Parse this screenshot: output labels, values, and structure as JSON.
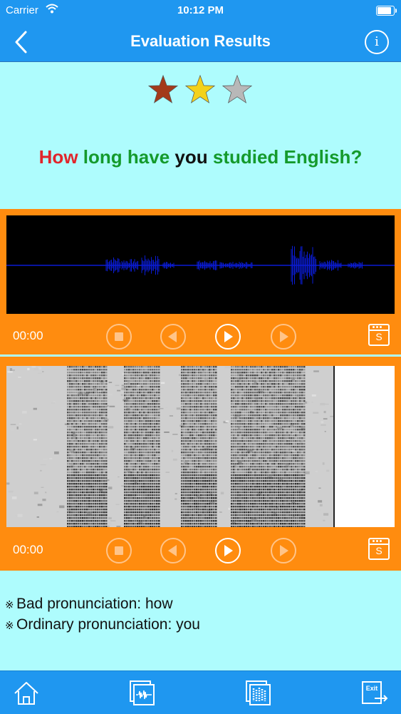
{
  "status_bar": {
    "carrier": "Carrier",
    "time": "10:12 PM",
    "wifi_icon": "wifi-icon",
    "battery_icon": "battery-icon"
  },
  "nav": {
    "title": "Evaluation Results",
    "back_icon": "chevron-left-icon",
    "info_icon": "info-icon",
    "info_glyph": "i"
  },
  "rating": {
    "stars": 3,
    "colors": [
      "#a33a1a",
      "#f3d21a",
      "#b8b8b8"
    ]
  },
  "sentence": {
    "words": [
      {
        "text": "How",
        "color": "#e0252b"
      },
      {
        "text": "long",
        "color": "#149a2c"
      },
      {
        "text": "have",
        "color": "#149a2c"
      },
      {
        "text": "you",
        "color": "#111111"
      },
      {
        "text": "studied",
        "color": "#149a2c"
      },
      {
        "text": "English?",
        "color": "#149a2c"
      }
    ]
  },
  "player1": {
    "time": "00:00",
    "save_letter": "S"
  },
  "player2": {
    "time": "00:00",
    "save_letter": "S"
  },
  "notes": {
    "mark": "※",
    "bad": "Bad pronunciation: how",
    "ordinary": "Ordinary pronunciation: you"
  },
  "tabbar": {
    "exit_label": "Exit"
  },
  "colors": {
    "bar": "#1f97f0",
    "background": "#aefcfd",
    "panel": "#ff8c0f",
    "wave": "#0a1bd6"
  }
}
